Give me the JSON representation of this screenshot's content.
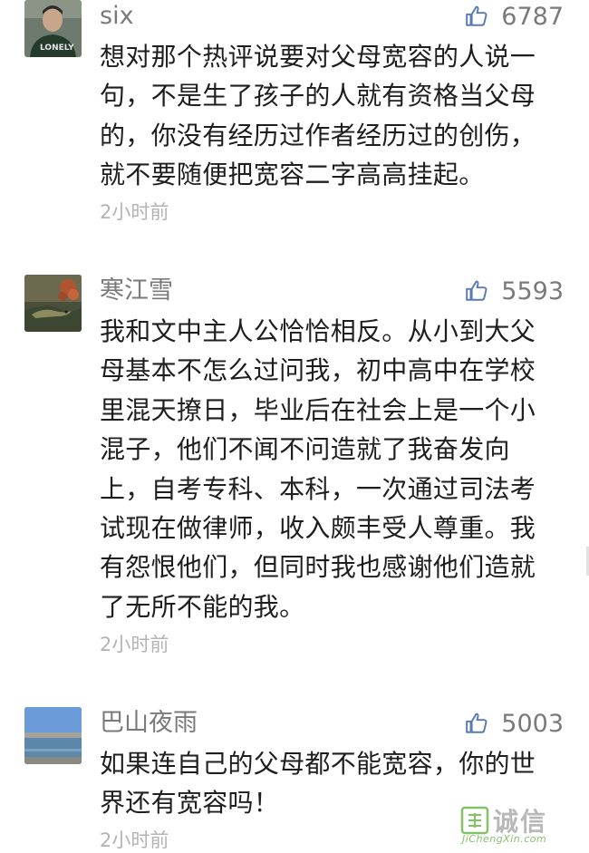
{
  "comments": [
    {
      "author": "six",
      "likes": "6787",
      "text": "想对那个热评说要对父母宽容的人说一句，不是生了孩子的人就有资格当父母的，你没有经历过作者经历过的创伤，就不要随便把宽容二字高高挂起。",
      "time": "2小时前",
      "avatar_icon": "person-avatar-icon"
    },
    {
      "author": "寒江雪",
      "likes": "5593",
      "text": "我和文中主人公恰恰相反。从小到大父母基本不怎么过问我，初中高中在学校里混天撩日，毕业后在社会上是一个小混子，他们不闻不问造就了我奋发向上，自考专科、本科，一次通过司法考试现在做律师，收入颇丰受人尊重。我有怨恨他们，但同时我也感谢他们造就了无所不能的我。",
      "time": "2小时前",
      "avatar_icon": "lizard-avatar-icon"
    },
    {
      "author": "巴山夜雨",
      "likes": "5003",
      "text": "如果连自己的父母都不能宽容，你的世界还有宽容吗！",
      "time": "2小时前",
      "avatar_icon": "lake-avatar-icon"
    }
  ],
  "watermark": {
    "title": "诚信",
    "subtitle": "JiChengXin.com"
  },
  "colors": {
    "like_icon": "#5a7ab3",
    "meta_text": "#7a7a7a",
    "time_text": "#b3b3b3",
    "body_text": "#1e1e1e",
    "watermark_green": "#86c06a"
  }
}
